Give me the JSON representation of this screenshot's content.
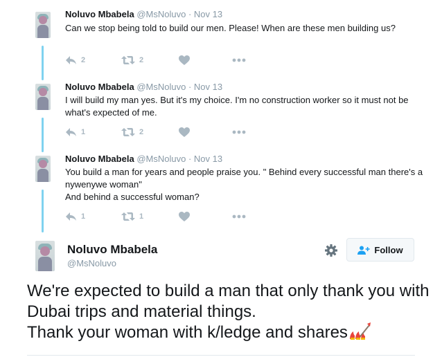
{
  "thread": [
    {
      "name": "Noluvo Mbabela",
      "handle": "@MsNoluvo",
      "date": "Nov 13",
      "text": "Can we stop being told to build our men. Please! When are these men building us?",
      "replies": "2",
      "retweets": "2"
    },
    {
      "name": "Noluvo Mbabela",
      "handle": "@MsNoluvo",
      "date": "Nov 13",
      "text": "I will build my man yes. But it's my choice. I'm no construction worker so it must not be what's expected of me.",
      "replies": "1",
      "retweets": "2"
    },
    {
      "name": "Noluvo Mbabela",
      "handle": "@MsNoluvo",
      "date": "Nov 13",
      "text": "You build a man for years and people praise you. \" Behind every successful man there's a nywenywe woman\"\nAnd behind a successful woman?",
      "replies": "1",
      "retweets": "1"
    }
  ],
  "separator": "·",
  "main": {
    "name": "Noluvo Mbabela",
    "handle": "@MsNoluvo",
    "follow_label": "Follow",
    "text": "We're expected to build a man that only thank you with Dubai trips and material things.\nThank your woman with k/ledge and shares"
  },
  "icons": {
    "reply": "reply-icon",
    "retweet": "retweet-icon",
    "like": "heart-icon",
    "more": "more-icon",
    "gear": "gear-icon",
    "follow": "add-user-icon",
    "emoji": "nail-polish-shovel-emoji"
  },
  "colors": {
    "action_gray": "#aab8c2",
    "thread_line": "#7fd2ef",
    "follow_blue": "#1da1f2"
  }
}
